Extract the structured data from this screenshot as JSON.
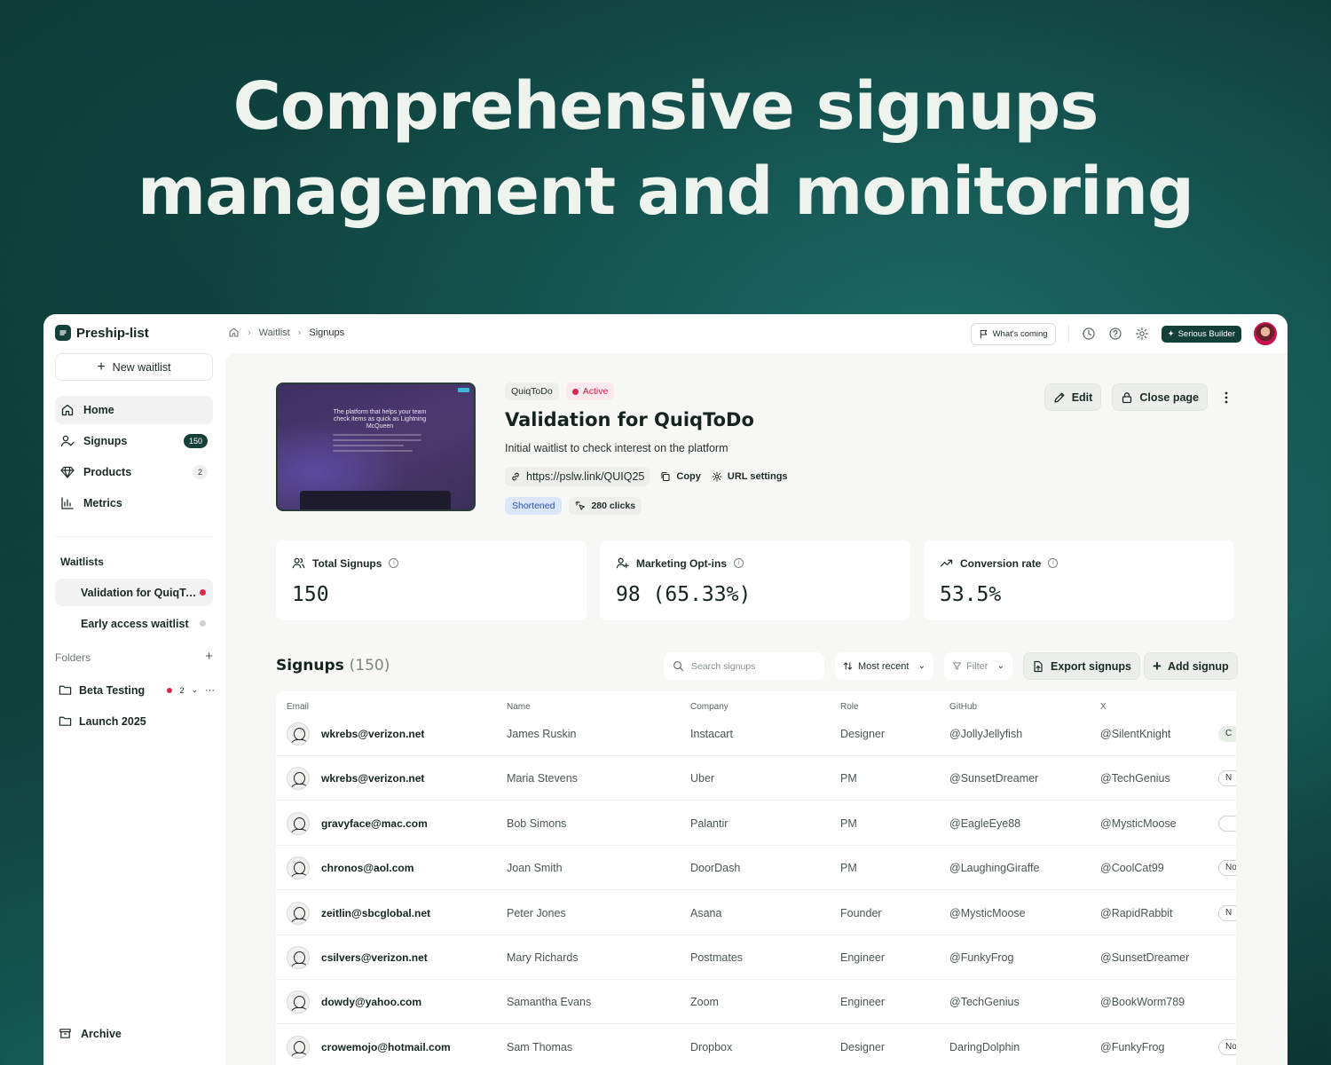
{
  "hero": {
    "line1": "Comprehensive signups",
    "line2": "management and monitoring"
  },
  "sidebar": {
    "brand": "Preship-list",
    "new_waitlist": "New waitlist",
    "nav": [
      {
        "label": "Home",
        "icon": "home-icon",
        "badge": ""
      },
      {
        "label": "Signups",
        "icon": "user-check-icon",
        "badge": "150"
      },
      {
        "label": "Products",
        "icon": "gem-icon",
        "badge": "2"
      },
      {
        "label": "Metrics",
        "icon": "bar-chart-icon",
        "badge": ""
      }
    ],
    "waitlists_label": "Waitlists",
    "waitlists": [
      {
        "label": "Validation for QuiqToDo",
        "status_color": "#e0254d"
      },
      {
        "label": "Early access waitlist",
        "status_color": "#cfd3cf"
      }
    ],
    "folders_label": "Folders",
    "folders": [
      {
        "label": "Beta Testing",
        "count": "2"
      },
      {
        "label": "Launch 2025",
        "count": ""
      }
    ],
    "archive": "Archive"
  },
  "topbar": {
    "breadcrumbs": [
      "Waitlist",
      "Signups"
    ],
    "whats_coming": "What's coming",
    "plan": "Serious Builder"
  },
  "waitlist": {
    "preview_headline": "The platform that helps your team check items as quick as Lightning McQueen",
    "tag": "QuiqToDo",
    "status": "Active",
    "title": "Validation for QuiqToDo",
    "description": "Initial waitlist to check interest on the platform",
    "url": "https://pslw.link/QUIQ25",
    "copy_label": "Copy",
    "url_settings_label": "URL settings",
    "shortened_label": "Shortened",
    "clicks_label": "280 clicks",
    "edit_label": "Edit",
    "close_label": "Close page"
  },
  "stats": [
    {
      "label": "Total Signups",
      "value": "150",
      "icon": "users-icon"
    },
    {
      "label": "Marketing Opt-ins",
      "value": "98 (65.33%)",
      "icon": "user-plus-icon"
    },
    {
      "label": "Conversion rate",
      "value": "53.5%",
      "icon": "trending-up-icon"
    }
  ],
  "signups": {
    "title": "Signups",
    "count": "(150)",
    "search_placeholder": "Search signups",
    "sort_label": "Most recent",
    "filter_label": "Filter",
    "export_label": "Export signups",
    "add_label": "Add signup",
    "columns": [
      "Email",
      "Name",
      "Company",
      "Role",
      "GitHub",
      "X"
    ],
    "rows": [
      {
        "email": "wkrebs@verizon.net",
        "name": "James Ruskin",
        "company": "Instacart",
        "role": "Designer",
        "github": "@JollyJellyfish",
        "x": "@SilentKnight",
        "tail": "C"
      },
      {
        "email": "wkrebs@verizon.net",
        "name": "Maria Stevens",
        "company": "Uber",
        "role": "PM",
        "github": "@SunsetDreamer",
        "x": "@TechGenius",
        "tail": "N"
      },
      {
        "email": "gravyface@mac.com",
        "name": "Bob Simons",
        "company": "Palantir",
        "role": "PM",
        "github": "@EagleEye88",
        "x": "@MysticMoose",
        "tail": ""
      },
      {
        "email": "chronos@aol.com",
        "name": "Joan Smith",
        "company": "DoorDash",
        "role": "PM",
        "github": "@LaughingGiraffe",
        "x": "@CoolCat99",
        "tail": "No"
      },
      {
        "email": "zeitlin@sbcglobal.net",
        "name": "Peter Jones",
        "company": "Asana",
        "role": "Founder",
        "github": "@MysticMoose",
        "x": "@RapidRabbit",
        "tail": "N"
      },
      {
        "email": "csilvers@verizon.net",
        "name": "Mary Richards",
        "company": "Postmates",
        "role": "Engineer",
        "github": "@FunkyFrog",
        "x": "@SunsetDreamer",
        "tail": ""
      },
      {
        "email": "dowdy@yahoo.com",
        "name": "Samantha Evans",
        "company": "Zoom",
        "role": "Engineer",
        "github": "@TechGenius",
        "x": "@BookWorm789",
        "tail": ""
      },
      {
        "email": "crowemojo@hotmail.com",
        "name": "Sam Thomas",
        "company": "Dropbox",
        "role": "Designer",
        "github": "DaringDolphin",
        "x": "@FunkyFrog",
        "tail": "No"
      }
    ]
  }
}
